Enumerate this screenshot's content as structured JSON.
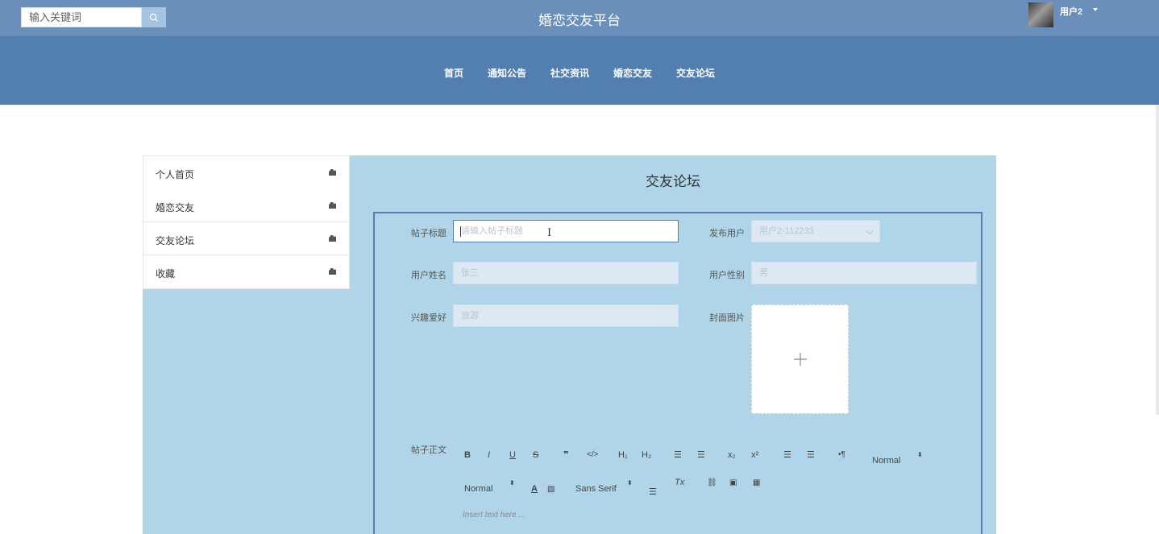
{
  "header": {
    "search_placeholder": "输入关键词",
    "site_title": "婚恋交友平台",
    "user_name": "用户2"
  },
  "nav": {
    "items": [
      "首页",
      "通知公告",
      "社交资讯",
      "婚恋交友",
      "交友论坛"
    ]
  },
  "sidebar": {
    "items": [
      "个人首页",
      "婚恋交友",
      "交友论坛",
      "收藏"
    ]
  },
  "main": {
    "title": "交友论坛",
    "form": {
      "post_title_label": "帖子标题",
      "post_title_placeholder": "请输入帖子标题",
      "publish_user_label": "发布用户",
      "publish_user_value": "用户2-112233",
      "user_name_label": "用户姓名",
      "user_name_value": "张三",
      "user_gender_label": "用户性别",
      "user_gender_value": "男",
      "hobby_label": "兴趣爱好",
      "hobby_value": "旅游",
      "cover_label": "封面图片",
      "body_label": "帖子正文",
      "editor_placeholder": "Insert text here ..."
    },
    "toolbar": {
      "header_select": "Normal",
      "size_select": "Normal",
      "font_select": "Sans Serif"
    }
  },
  "colors": {
    "topbar": "#6b8fbb",
    "navbar": "#527fb0",
    "panel_bg": "#b1d5e8",
    "accent": "#527fb0"
  }
}
